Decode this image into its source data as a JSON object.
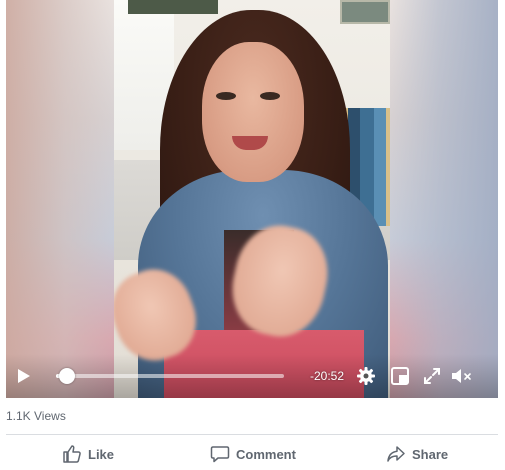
{
  "video": {
    "time_remaining": "-20:52",
    "progress_fraction": 0.02
  },
  "icons": {
    "play": "play-icon",
    "settings": "gear-icon",
    "picture_in_picture": "pip-icon",
    "fullscreen": "fullscreen-icon",
    "mute": "volume-muted-icon",
    "like": "thumbs-up-icon",
    "comment": "speech-bubble-icon",
    "share": "share-arrow-icon"
  },
  "stats": {
    "views": "1.1K Views"
  },
  "actions": {
    "like_label": "Like",
    "comment_label": "Comment",
    "share_label": "Share"
  },
  "colors": {
    "action_text": "#606770",
    "divider": "#dadde1"
  }
}
